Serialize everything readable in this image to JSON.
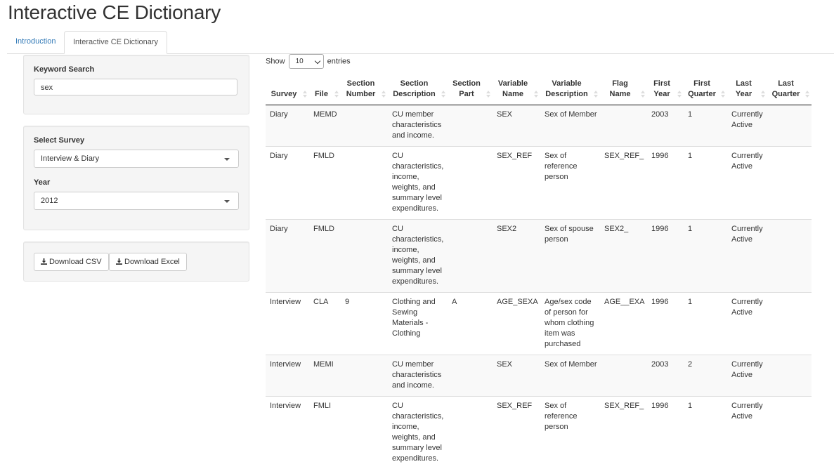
{
  "app": {
    "title": "Interactive CE Dictionary"
  },
  "tabs": [
    "Introduction",
    "Interactive CE Dictionary"
  ],
  "sidebar": {
    "keyword_label": "Keyword Search",
    "keyword_value": "sex",
    "survey_label": "Select Survey",
    "survey_value": "Interview & Diary",
    "year_label": "Year",
    "year_value": "2012",
    "download_csv": "Download CSV",
    "download_excel": "Download Excel"
  },
  "table_controls": {
    "show": "Show",
    "entries_value": "10",
    "entries": "entries"
  },
  "table": {
    "headers": [
      "Survey",
      "File",
      "Section Number",
      "Section Description",
      "Section Part",
      "Variable Name",
      "Variable Description",
      "Flag Name",
      "First Year",
      "First Quarter",
      "Last Year",
      "Last Quarter"
    ],
    "rows": [
      [
        "Diary",
        "MEMD",
        "",
        "CU member characteristics and income.",
        "",
        "SEX",
        "Sex of Member",
        "",
        "2003",
        "1",
        "Currently Active",
        ""
      ],
      [
        "Diary",
        "FMLD",
        "",
        "CU characteristics, income, weights, and summary level expenditures.",
        "",
        "SEX_REF",
        "Sex of reference person",
        "SEX_REF_",
        "1996",
        "1",
        "Currently Active",
        ""
      ],
      [
        "Diary",
        "FMLD",
        "",
        "CU characteristics, income, weights, and summary level expenditures.",
        "",
        "SEX2",
        "Sex of spouse person",
        "SEX2_",
        "1996",
        "1",
        "Currently Active",
        ""
      ],
      [
        "Interview",
        "CLA",
        "9",
        "Clothing and Sewing Materials - Clothing",
        "A",
        "AGE_SEXA",
        "Age/sex code of person for whom clothing item was purchased",
        "AGE__EXA",
        "1996",
        "1",
        "Currently Active",
        ""
      ],
      [
        "Interview",
        "MEMI",
        "",
        "CU member characteristics and income.",
        "",
        "SEX",
        "Sex of Member",
        "",
        "2003",
        "2",
        "Currently Active",
        ""
      ],
      [
        "Interview",
        "FMLI",
        "",
        "CU characteristics, income, weights, and summary level expenditures.",
        "",
        "SEX_REF",
        "Sex of reference person",
        "SEX_REF_",
        "1996",
        "1",
        "Currently Active",
        ""
      ]
    ]
  }
}
